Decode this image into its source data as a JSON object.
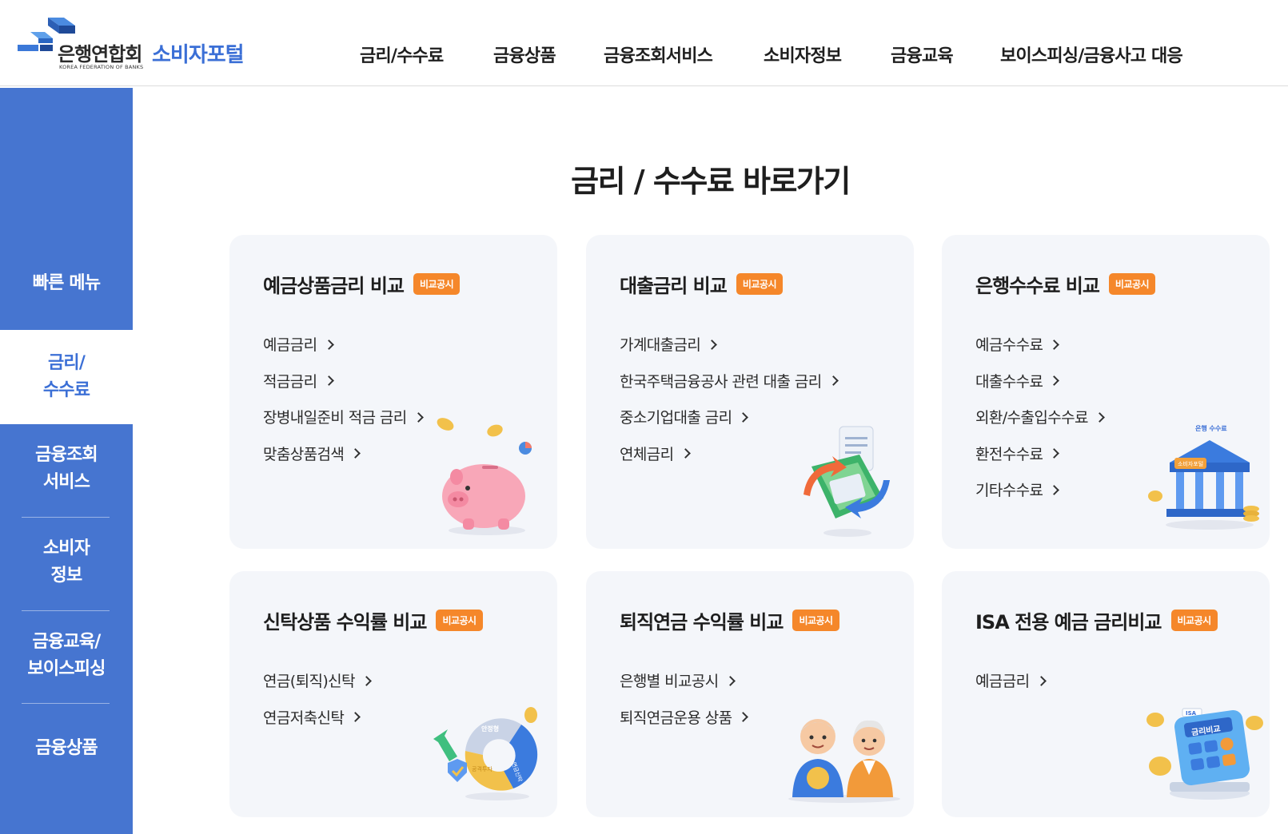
{
  "header": {
    "logo": {
      "ko": "은행연합회",
      "en": "KOREA FEDERATION OF BANKS",
      "portal": "소비자포털"
    },
    "nav": [
      "금리/수수료",
      "금융상품",
      "금융조회서비스",
      "소비자정보",
      "금융교육",
      "보이스피싱/금융사고 대응"
    ]
  },
  "sidebar": {
    "items": [
      {
        "lines": [
          "빠른 메뉴"
        ],
        "active": false
      },
      {
        "lines": [
          "금리/",
          "수수료"
        ],
        "active": true
      },
      {
        "lines": [
          "금융조회",
          "서비스"
        ],
        "active": false
      },
      {
        "lines": [
          "소비자",
          "정보"
        ],
        "active": false
      },
      {
        "lines": [
          "금융교육/",
          "보이스피싱"
        ],
        "active": false
      },
      {
        "lines": [
          "금융상품"
        ],
        "active": false
      }
    ]
  },
  "main": {
    "title": "금리 / 수수료 바로가기",
    "cards": [
      {
        "title": "예금상품금리 비교",
        "badge": "비교공시",
        "links": [
          "예금금리",
          "적금금리",
          "장병내일준비 적금 금리",
          "맞춤상품검색"
        ],
        "icon": "piggy-bank-icon"
      },
      {
        "title": "대출금리 비교",
        "badge": "비교공시",
        "links": [
          "가계대출금리",
          "한국주택금융공사 관련 대출 금리",
          "중소기업대출 금리",
          "연체금리"
        ],
        "icon": "money-exchange-icon"
      },
      {
        "title": "은행수수료 비교",
        "badge": "비교공시",
        "links": [
          "예금수수료",
          "대출수수료",
          "외환/수출입수수료",
          "환전수수료",
          "기타수수료"
        ],
        "icon": "bank-building-icon",
        "illus_text": {
          "top": "은행 수수료",
          "sign": "소비자포털"
        }
      },
      {
        "title": "신탁상품 수익률 비교",
        "badge": "비교공시",
        "links": [
          "연금(퇴직)신탁",
          "연금저축신탁"
        ],
        "icon": "donut-chart-icon",
        "illus_text": {
          "a": "안정형",
          "b": "공격투자",
          "c": "연금신탁"
        }
      },
      {
        "title": "퇴직연금 수익률 비교",
        "badge": "비교공시",
        "links": [
          "은행별 비교공시",
          "퇴직연금운용 상품"
        ],
        "icon": "retired-couple-icon"
      },
      {
        "title": "ISA 전용 예금 금리비교",
        "badge": "비교공시",
        "links": [
          "예금금리"
        ],
        "icon": "calculator-icon",
        "illus_text": {
          "tag": "ISA",
          "label": "금리비교"
        }
      }
    ]
  },
  "colors": {
    "primary": "#4675d0",
    "portal_text": "#3b6fd6",
    "badge": "#f5872a",
    "card_bg": "#f4f6fa"
  }
}
